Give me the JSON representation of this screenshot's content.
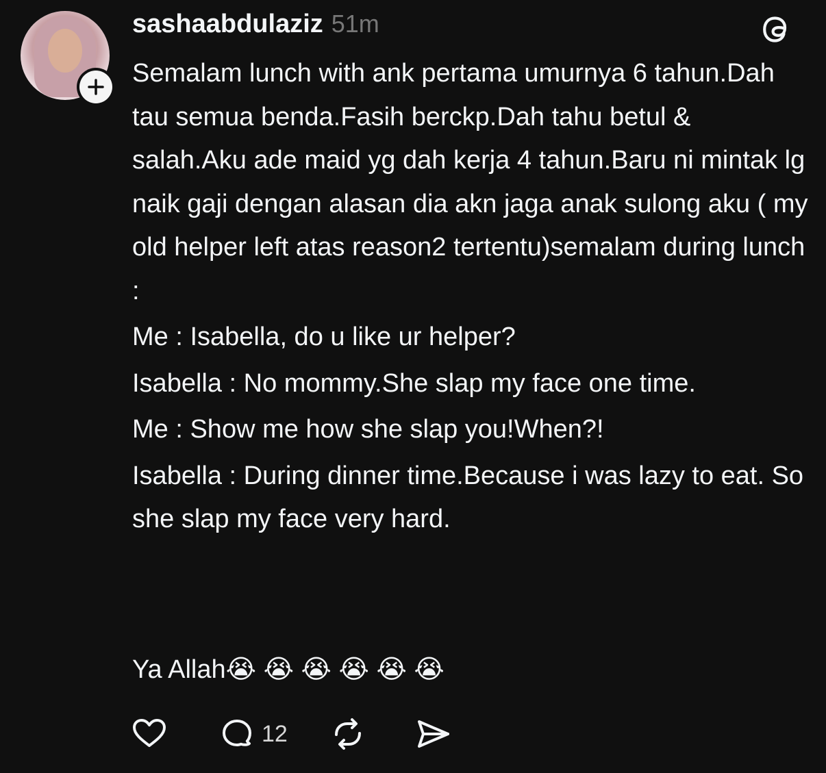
{
  "post": {
    "username": "sashaabdulaziz",
    "timestamp": "51m",
    "paragraphs": [
      "Semalam lunch with ank pertama umurnya 6 tahun.Dah tau semua benda.Fasih berckp.Dah tahu betul & salah.Aku ade maid yg dah kerja 4 tahun.Baru ni mintak lg naik gaji dengan alasan dia akn jaga anak sulong aku ( my old helper left atas reason2 tertentu)semalam during lunch :",
      "Me : Isabella, do u like ur helper?",
      "Isabella : No mommy.She slap my face one time.",
      "Me : Show me how she slap you!When?!",
      "Isabella : During dinner time.Because i was lazy to eat. So she slap my face very hard."
    ],
    "closing_text": "Ya Allah😭 😭 😭 😭 😭 😭",
    "reply_count": "12"
  },
  "icons": {
    "avatar": "profile-photo",
    "follow": "plus-icon",
    "app_logo": "threads-logo-icon",
    "like": "heart-icon",
    "reply": "comment-bubble-icon",
    "repost": "repost-icon",
    "share": "send-icon"
  },
  "colors": {
    "background": "#101010",
    "text": "#f3f5f7",
    "muted": "#777777"
  }
}
